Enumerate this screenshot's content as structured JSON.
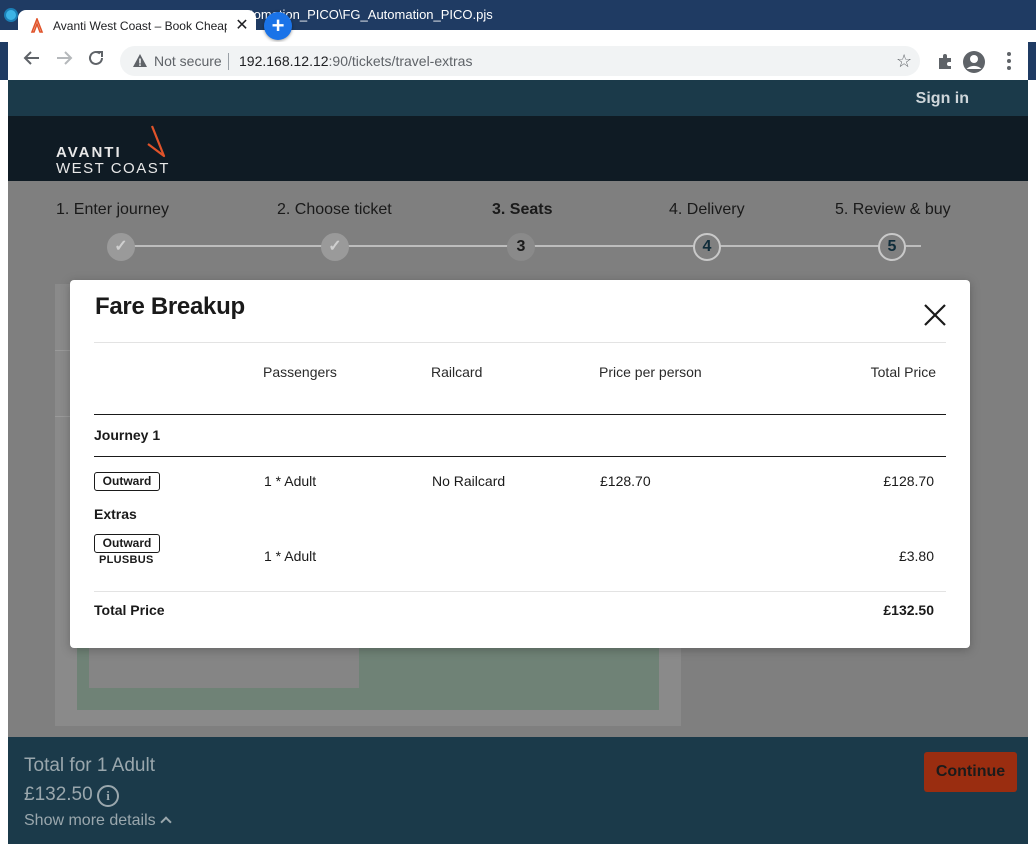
{
  "window": {
    "title_text": "Automation_PICO\\FG_Automation_PICO.pjs",
    "visible_title": "tomation_PICO\\FG_Automation_PICO.pjs"
  },
  "browser": {
    "tab_title": "Avanti West Coast – Book Cheap",
    "security_label": "Not secure",
    "url_host": "192.168.12.12",
    "url_path": ":90/tickets/travel-extras"
  },
  "site": {
    "sign_in_label": "Sign in",
    "logo_line1": "AVANTI",
    "logo_line2": "WEST COAST",
    "brand_color": "#e0532a"
  },
  "steps": [
    {
      "label": "1. Enter journey",
      "state": "done",
      "marker": "✓"
    },
    {
      "label": "2. Choose ticket",
      "state": "done",
      "marker": "✓"
    },
    {
      "label": "3. Seats",
      "state": "current",
      "marker": "3"
    },
    {
      "label": "4. Delivery",
      "state": "future",
      "marker": "4"
    },
    {
      "label": "5. Review & buy",
      "state": "future",
      "marker": "5"
    }
  ],
  "modal": {
    "title": "Fare Breakup",
    "columns": {
      "passengers": "Passengers",
      "railcard": "Railcard",
      "price_per_person": "Price per person",
      "total_price": "Total Price"
    },
    "journey_heading": "Journey 1",
    "outward_row": {
      "tag": "Outward",
      "passengers": "1 * Adult",
      "railcard": "No Railcard",
      "price_per_person": "£128.70",
      "total": "£128.70"
    },
    "extras_heading": "Extras",
    "extras_row": {
      "tag": "Outward",
      "sub_label": "PLUSBUS",
      "passengers": "1 * Adult",
      "total": "£3.80"
    },
    "total_label": "Total Price",
    "total_value": "£132.50"
  },
  "footer": {
    "total_label": "Total for 1 Adult",
    "total_amount": "£132.50",
    "show_more": "Show more details",
    "continue_label": "Continue",
    "continue_color": "#9a2d10"
  }
}
